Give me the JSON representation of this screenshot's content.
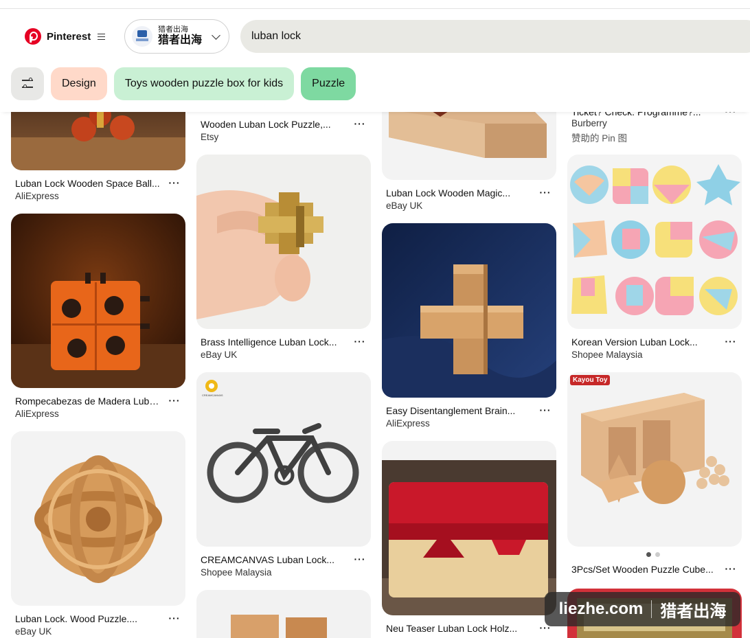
{
  "header": {
    "brand": "Pinterest",
    "account_subtitle": "猎者出海",
    "account_name": "猎者出海",
    "search_value": "luban lock"
  },
  "chips": [
    {
      "label": "Design",
      "color": "#ffd9c9"
    },
    {
      "label": "Toys wooden puzzle box for kids",
      "color": "#c9f0d4"
    },
    {
      "label": "Puzzle",
      "color": "#7ed9a1"
    }
  ],
  "pins": {
    "c1_1": {
      "title": "Luban Lock Wooden Space Ball...",
      "source": "AliExpress"
    },
    "c1_2": {
      "title": "Rompecabezas de Madera Luba...",
      "source": "AliExpress"
    },
    "c1_3": {
      "title": "Luban Lock. Wood Puzzle....",
      "source": "eBay UK"
    },
    "c2_1": {
      "title": "Wooden Luban Lock Puzzle,...",
      "source": "Etsy"
    },
    "c2_2": {
      "title": "Brass Intelligence Luban Lock...",
      "source": "eBay UK"
    },
    "c2_3": {
      "title": "CREAMCANVAS Luban Lock...",
      "source": "Shopee Malaysia",
      "image_caption": "CREAMCANVAS"
    },
    "c3_1": {
      "title": "Luban Lock Wooden Magic...",
      "source": "eBay UK"
    },
    "c3_2": {
      "title": "Easy Disentanglement Brain...",
      "source": "AliExpress"
    },
    "c3_3": {
      "title": "Neu Teaser Luban Lock Holz..."
    },
    "c4_1": {
      "title": "Ticket? Check. Programme?...",
      "source": "Burberry",
      "sponsor": "赞助的 Pin 图"
    },
    "c4_2": {
      "title": "Korean Version Luban Lock...",
      "source": "Shopee Malaysia"
    },
    "c4_3": {
      "title": "3Pcs/Set Wooden Puzzle Cube...",
      "badge": "Kayou Toy"
    }
  },
  "more_label": "···",
  "watermark": {
    "left": "liezhe.com",
    "right": "猎者出海"
  }
}
